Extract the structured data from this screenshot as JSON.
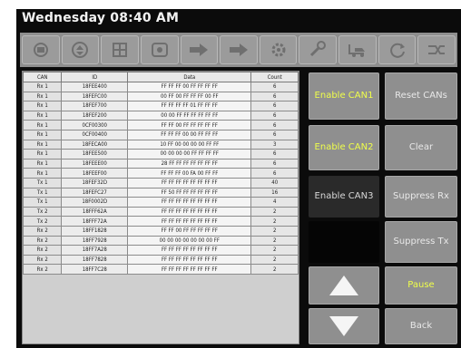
{
  "title": "Wednesday 08:40 AM",
  "toolbar": {
    "icons": [
      "ecu-icon",
      "arrows-icon",
      "grid-icon",
      "engine-icon",
      "right-arrow-icon",
      "right-arrow-icon",
      "gear-icon",
      "wrench-icon",
      "truck-icon",
      "refresh-icon",
      "shuffle-icon"
    ]
  },
  "table": {
    "headers": [
      "CAN",
      "ID",
      "Data",
      "Count"
    ],
    "rows": [
      [
        "Rx 1",
        "18FEE400",
        "FF FF FF 00 FF FF FF FF",
        "6"
      ],
      [
        "Rx 1",
        "18FEFC00",
        "00 FF 00 FF FF FF 00 FF",
        "6"
      ],
      [
        "Rx 1",
        "18FEF700",
        "FF FF FF FF 01 FF FF FF",
        "6"
      ],
      [
        "Rx 1",
        "18FEF200",
        "00 00 FF FF FF FF FF FF",
        "6"
      ],
      [
        "Rx 1",
        "0CF00300",
        "FF FF 00 FF FF FF FF FF",
        "6"
      ],
      [
        "Rx 1",
        "0CF00400",
        "FF FF FF 00 00 FF FF FF",
        "6"
      ],
      [
        "Rx 1",
        "18FECA00",
        "10 FF 00 00 00 00 FF FF",
        "3"
      ],
      [
        "Rx 1",
        "18FEE500",
        "00 00 00 00 FF FF FF FF",
        "6"
      ],
      [
        "Rx 1",
        "18FEEE00",
        "28 FF FF FF FF FF FF FF",
        "6"
      ],
      [
        "Rx 1",
        "18FEEF00",
        "FF FF FF 00 FA 00 FF FF",
        "6"
      ],
      [
        "Tx 1",
        "18FEF32D",
        "FF FF FF FF FF FF FF FF",
        "40"
      ],
      [
        "Tx 1",
        "18FEFC27",
        "FF 50 FF FF FF FF FF FF",
        "16"
      ],
      [
        "Tx 1",
        "18F0002D",
        "FF FF FF FF FF FF FF FF",
        "4"
      ],
      [
        "Tx 2",
        "18FFF62A",
        "FF FF FF FF FF FF FF FF",
        "2"
      ],
      [
        "Tx 2",
        "18FFF72A",
        "FF FF FF FF FF FF FF FF",
        "2"
      ],
      [
        "Rx 2",
        "18FF1828",
        "FF FF 00 FF FF FF FF FF",
        "2"
      ],
      [
        "Rx 2",
        "18FF7928",
        "00 00 00 00 00 00 00 FF",
        "2"
      ],
      [
        "Rx 2",
        "18FF7A28",
        "FF FF FF FF FF FF FF FF",
        "2"
      ],
      [
        "Rx 2",
        "18FF7828",
        "FF FF FF FF FF FF FF FF",
        "2"
      ],
      [
        "Rx 2",
        "18FF7C28",
        "FF FF FF FF FF FF FF FF",
        "2"
      ]
    ]
  },
  "buttons": {
    "enable_can1": "Enable CAN1",
    "reset_cans": "Reset CANs",
    "enable_can2": "Enable CAN2",
    "clear": "Clear",
    "enable_can3": "Enable CAN3",
    "suppress_rx": "Suppress Rx",
    "suppress_tx": "Suppress Tx",
    "pause": "Pause",
    "back": "Back"
  },
  "colors": {
    "enabled_text": "#f0ff4a",
    "button_bg": "#8f8f8f",
    "screen_bg": "#0b0b0b"
  }
}
